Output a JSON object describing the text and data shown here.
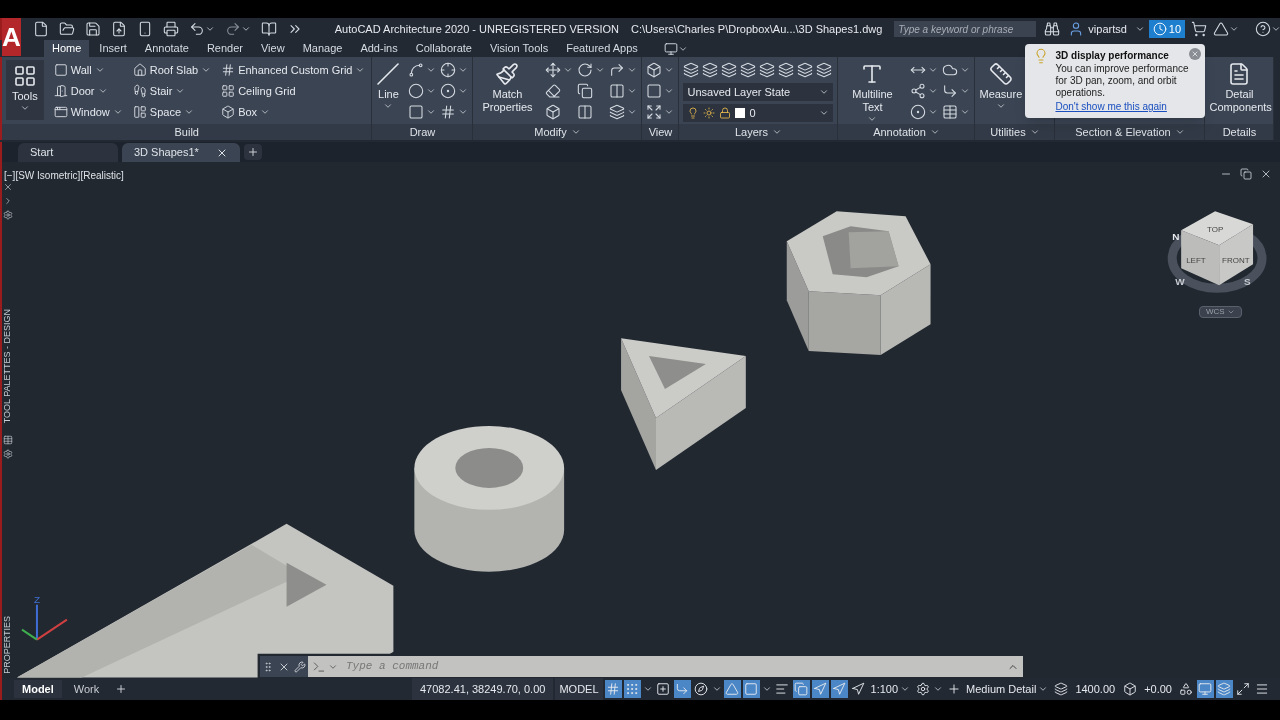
{
  "title_bar": {
    "app_button_letter": "A",
    "title": "AutoCAD Architecture 2020 - UNREGISTERED VERSION",
    "file_path": "C:\\Users\\Charles P\\Dropbox\\Au...\\3D Shapes1.dwg",
    "search": {
      "placeholder": "Type a keyword or phrase"
    },
    "user": "vipartsd",
    "notification_count": "10"
  },
  "ribbon_tabs": [
    {
      "label": "Home",
      "selected": true
    },
    {
      "label": "Insert",
      "selected": false
    },
    {
      "label": "Annotate",
      "selected": false
    },
    {
      "label": "Render",
      "selected": false
    },
    {
      "label": "View",
      "selected": false
    },
    {
      "label": "Manage",
      "selected": false
    },
    {
      "label": "Add-ins",
      "selected": false
    },
    {
      "label": "Collaborate",
      "selected": false
    },
    {
      "label": "Vision Tools",
      "selected": false
    },
    {
      "label": "Featured Apps",
      "selected": false
    }
  ],
  "ribbon_panels": [
    {
      "title": "Build",
      "has_menu": false,
      "items": [
        {
          "kind": "large",
          "label": "Tools",
          "dropdown": true
        },
        {
          "kind": "small",
          "label": "Wall",
          "dropdown": true
        },
        {
          "kind": "small",
          "label": "Door",
          "dropdown": true
        },
        {
          "kind": "small",
          "label": "Window",
          "dropdown": true
        },
        {
          "kind": "small",
          "label": "Roof Slab",
          "dropdown": true
        },
        {
          "kind": "small",
          "label": "Stair",
          "dropdown": true
        },
        {
          "kind": "small",
          "label": "Space",
          "dropdown": true
        },
        {
          "kind": "small",
          "label": "Enhanced Custom Grid",
          "dropdown": true
        },
        {
          "kind": "small",
          "label": "Ceiling Grid",
          "dropdown": false
        },
        {
          "kind": "small",
          "label": "Box",
          "dropdown": true
        }
      ]
    },
    {
      "title": "Draw",
      "has_menu": false,
      "items": [
        {
          "kind": "large",
          "label": "Line",
          "dropdown": true
        },
        {
          "kind": "icon",
          "dropdown": true
        },
        {
          "kind": "icon",
          "dropdown": true
        },
        {
          "kind": "icon",
          "dropdown": true
        },
        {
          "kind": "icon",
          "dropdown": true
        },
        {
          "kind": "icon",
          "dropdown": true
        },
        {
          "kind": "icon",
          "dropdown": true
        }
      ]
    },
    {
      "title": "Modify",
      "has_menu": true,
      "items": [
        {
          "kind": "large",
          "label": "Match Properties",
          "dropdown": false
        },
        {
          "kind": "icon",
          "dropdown": true
        },
        {
          "kind": "icon",
          "dropdown": false
        },
        {
          "kind": "icon",
          "dropdown": false
        },
        {
          "kind": "icon",
          "dropdown": true
        },
        {
          "kind": "icon",
          "dropdown": false
        },
        {
          "kind": "icon",
          "dropdown": false
        },
        {
          "kind": "icon",
          "dropdown": true
        },
        {
          "kind": "icon",
          "dropdown": true
        },
        {
          "kind": "icon",
          "dropdown": true
        }
      ]
    },
    {
      "title": "View",
      "has_menu": false,
      "items": [
        {
          "kind": "icon",
          "dropdown": true
        },
        {
          "kind": "icon",
          "dropdown": true
        },
        {
          "kind": "icon",
          "dropdown": true
        }
      ]
    },
    {
      "title": "Layers",
      "has_menu": true,
      "items": [
        {
          "kind": "icon",
          "dropdown": false
        },
        {
          "kind": "icon",
          "dropdown": false
        },
        {
          "kind": "icon",
          "dropdown": false
        },
        {
          "kind": "icon",
          "dropdown": false
        },
        {
          "kind": "icon",
          "dropdown": false
        },
        {
          "kind": "icon",
          "dropdown": false
        },
        {
          "kind": "icon",
          "dropdown": false
        },
        {
          "kind": "icon",
          "dropdown": false
        },
        {
          "kind": "select",
          "label": "Unsaved Layer State"
        },
        {
          "kind": "layer_select",
          "label": "0"
        }
      ]
    },
    {
      "title": "Annotation",
      "has_menu": true,
      "items": [
        {
          "kind": "large",
          "label": "Multiline Text",
          "dropdown": true
        },
        {
          "kind": "icon",
          "dropdown": true
        },
        {
          "kind": "icon",
          "dropdown": true
        },
        {
          "kind": "icon",
          "dropdown": true
        },
        {
          "kind": "icon",
          "dropdown": true
        },
        {
          "kind": "icon",
          "dropdown": true
        },
        {
          "kind": "icon",
          "dropdown": true
        }
      ]
    },
    {
      "title": "Utilities",
      "has_menu": true,
      "items": [
        {
          "kind": "large",
          "label": "Measure",
          "dropdown": true
        }
      ]
    },
    {
      "title": "Section & Elevation",
      "has_menu": true
    },
    {
      "title": "Details",
      "has_menu": false,
      "items": [
        {
          "kind": "large",
          "label": "Detail Components",
          "dropdown": false
        }
      ]
    }
  ],
  "tooltip": {
    "title": "3D display performance",
    "text": "You can improve performance for 3D pan, zoom, and orbit operations.",
    "link": "Don't show me this again"
  },
  "file_tabs": [
    {
      "label": "Start",
      "selected": false,
      "closable": false
    },
    {
      "label": "3D Shapes1*",
      "selected": true,
      "closable": true
    }
  ],
  "viewport": {
    "label": "[−][SW Isometric][Realistic]",
    "side_palettes": [
      "TOOL PALETTES - DESIGN",
      "PROPERTIES"
    ],
    "ucs_label": "Z",
    "viewcube": {
      "faces": [
        "TOP",
        "LEFT",
        "FRONT"
      ],
      "compass": [
        "N",
        "W",
        "S"
      ],
      "coordinate_system": "WCS"
    }
  },
  "command_line": {
    "placeholder": "Type a command"
  },
  "status_bar": {
    "layout_tabs": [
      {
        "label": "Model",
        "selected": true
      },
      {
        "label": "Work",
        "selected": false
      }
    ],
    "coordinates": "47082.41, 38249.70, 0.00",
    "space_button": "MODEL",
    "items": [
      {
        "kind": "toggle",
        "on": true
      },
      {
        "kind": "toggle",
        "on": true
      },
      {
        "kind": "menu"
      },
      {
        "kind": "toggle",
        "on": false
      },
      {
        "kind": "toggle",
        "on": true
      },
      {
        "kind": "toggle",
        "on": false
      },
      {
        "kind": "menu"
      },
      {
        "kind": "toggle",
        "on": true
      },
      {
        "kind": "toggle",
        "on": true
      },
      {
        "kind": "menu"
      },
      {
        "kind": "toggle",
        "on": false
      },
      {
        "kind": "toggle",
        "on": true
      },
      {
        "kind": "toggle",
        "on": true
      },
      {
        "kind": "toggle",
        "on": true
      },
      {
        "kind": "toggle",
        "on": false
      },
      {
        "kind": "value",
        "label": "1:100"
      },
      {
        "kind": "toggle",
        "on": false
      },
      {
        "kind": "menu"
      },
      {
        "kind": "toggle",
        "on": false
      },
      {
        "kind": "value",
        "label": "Medium Detail"
      },
      {
        "kind": "toggle",
        "on": false
      },
      {
        "kind": "text",
        "label": "1400.00"
      },
      {
        "kind": "toggle",
        "on": false
      },
      {
        "kind": "text",
        "label": "+0.00"
      },
      {
        "kind": "toggle",
        "on": false
      },
      {
        "kind": "toggle",
        "on": true
      },
      {
        "kind": "toggle",
        "on": true
      },
      {
        "kind": "toggle",
        "on": false
      },
      {
        "kind": "toggle",
        "on": false
      }
    ]
  }
}
